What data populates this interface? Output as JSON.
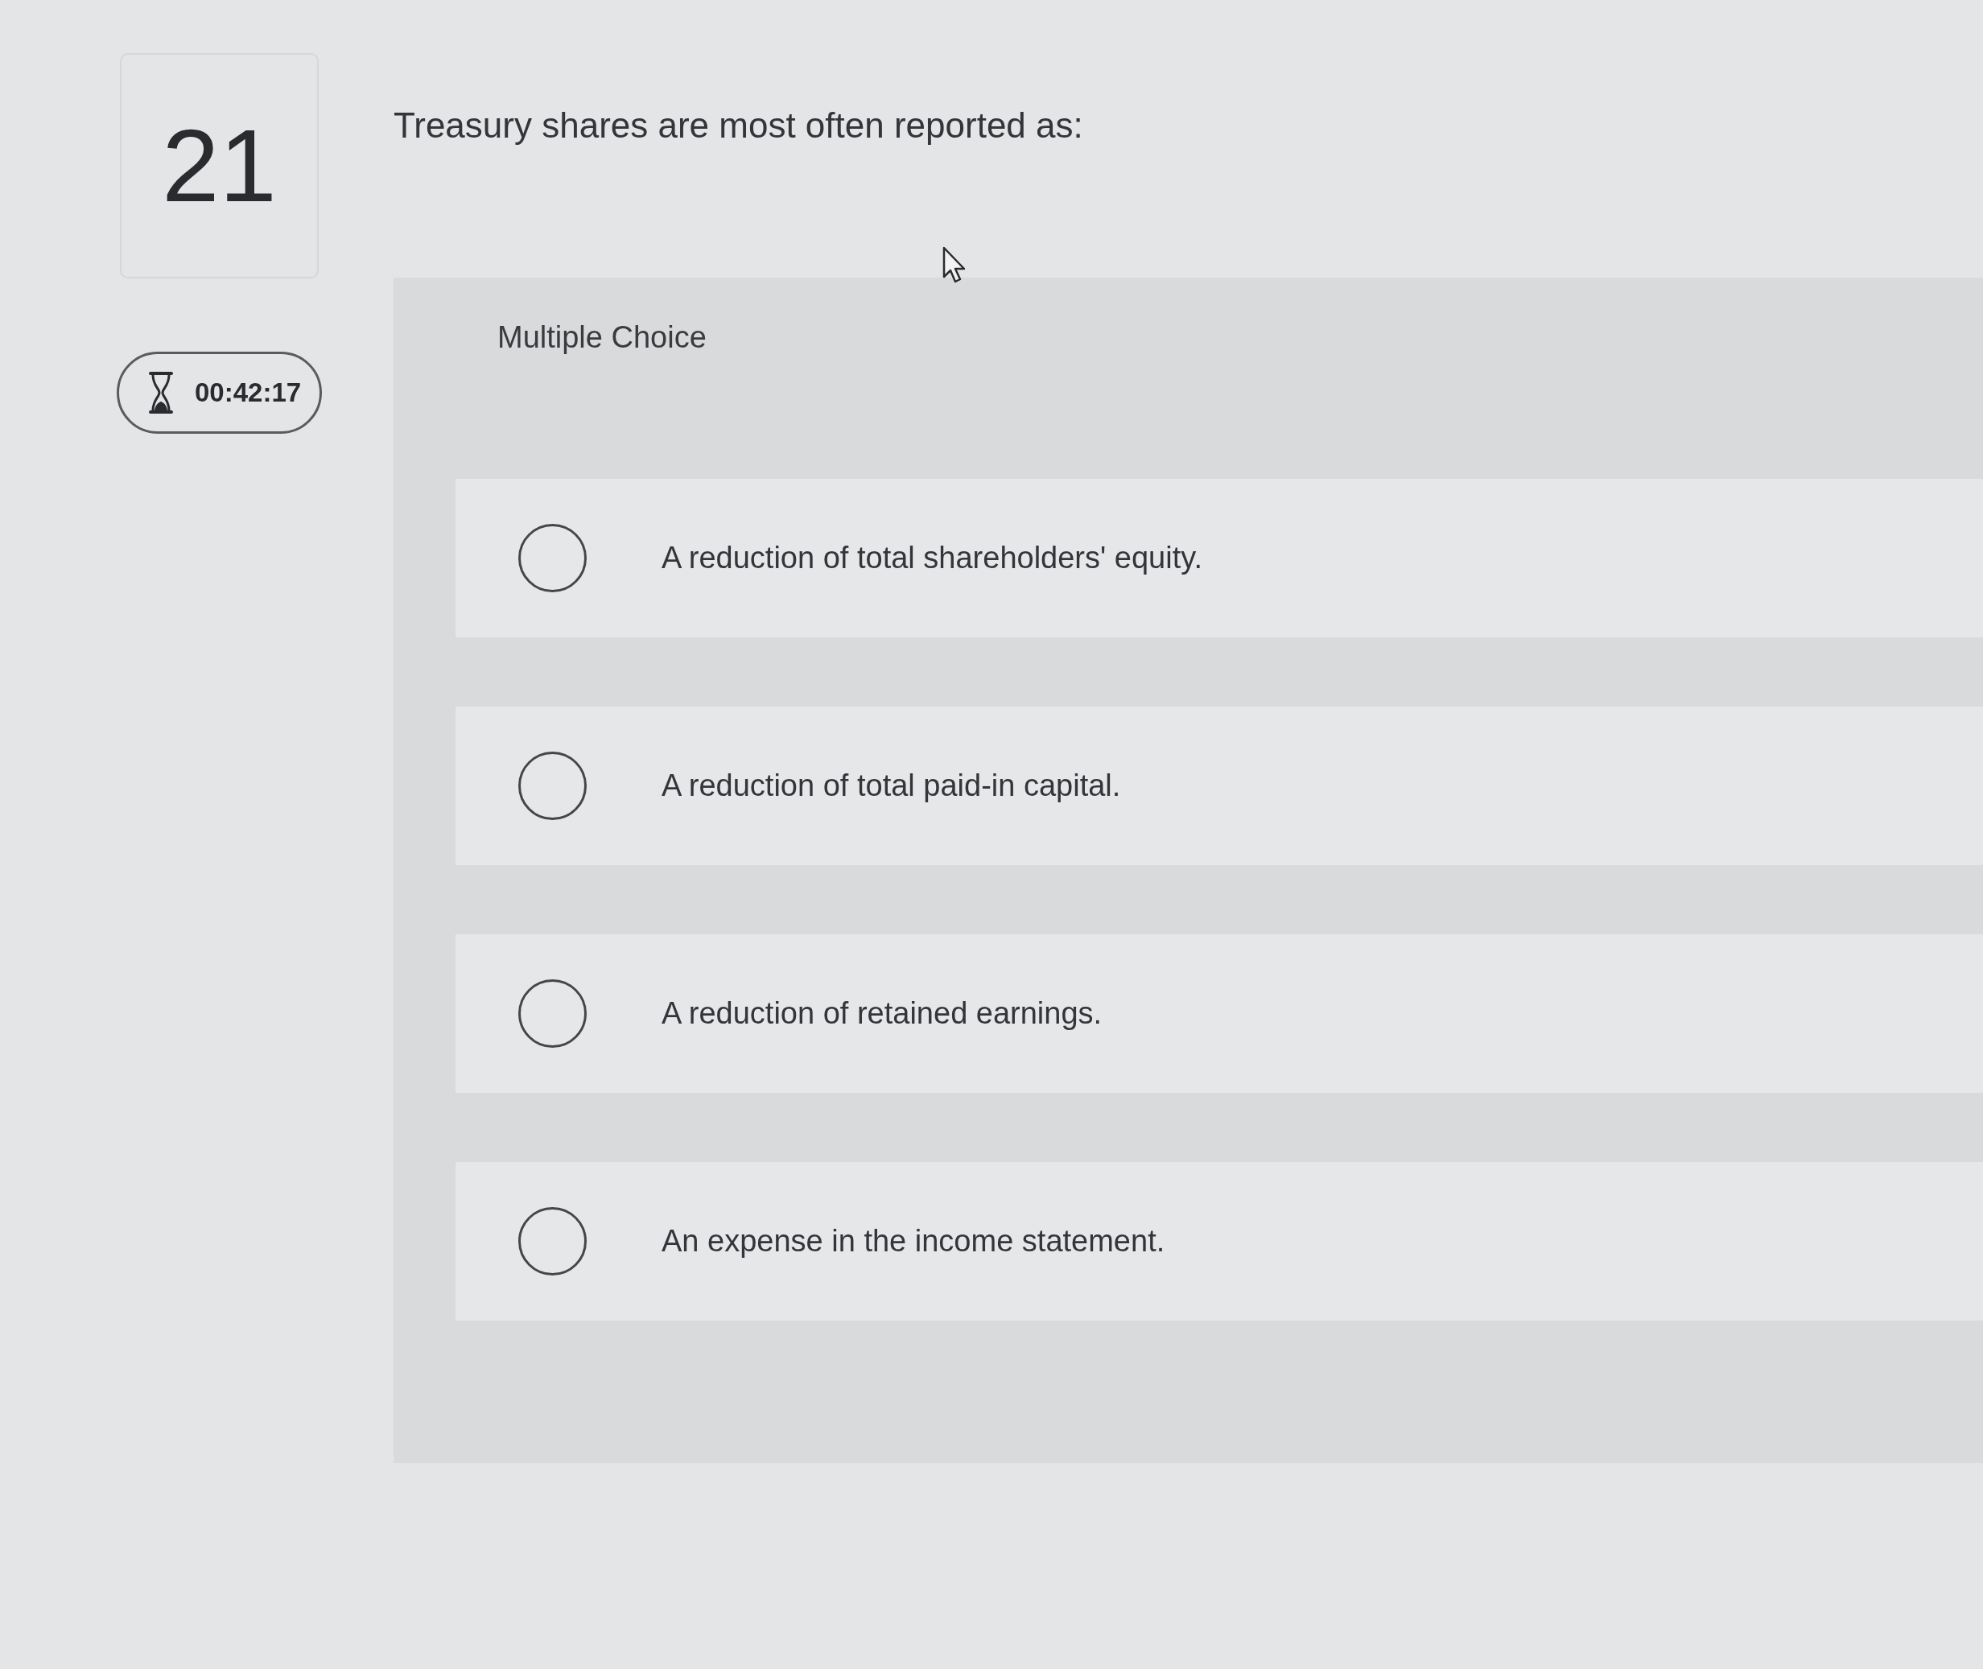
{
  "question": {
    "number": "21",
    "text": "Treasury shares are most often reported as:",
    "type_label": "Multiple Choice"
  },
  "timer": {
    "time": "00:42:17"
  },
  "options": [
    {
      "label": "A reduction of total shareholders' equity.",
      "selected": false
    },
    {
      "label": "A reduction of total paid-in capital.",
      "selected": false
    },
    {
      "label": "A reduction of retained earnings.",
      "selected": false
    },
    {
      "label": "An expense in the income statement.",
      "selected": false
    }
  ]
}
